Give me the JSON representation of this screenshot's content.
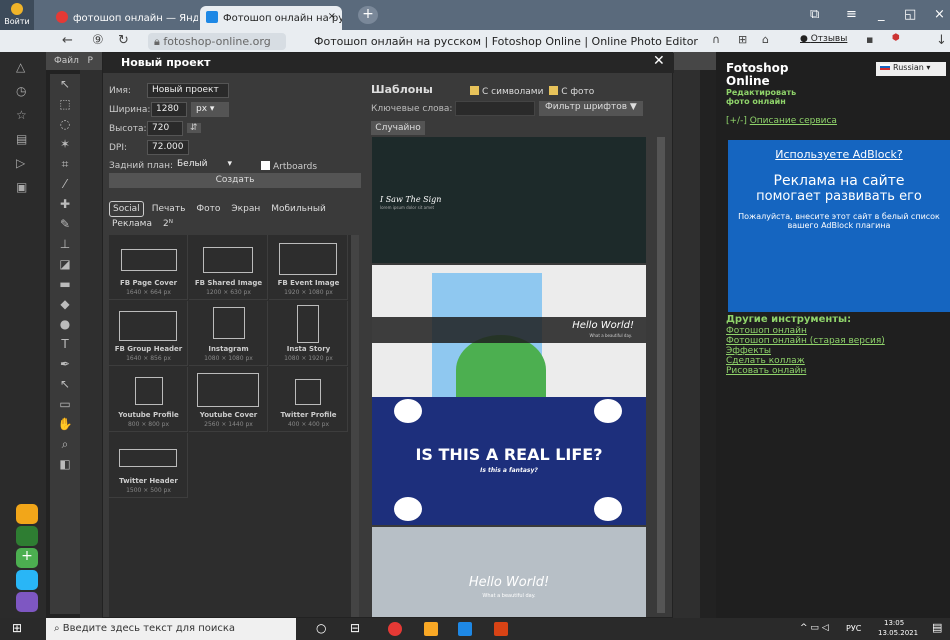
{
  "tabs": {
    "login": "Войти",
    "tab1": "фотошоп онлайн — Яндекс",
    "tab2": "Фотошоп онлайн на русском",
    "tab2_close": "×"
  },
  "address": {
    "url": "fotoshop-online.org",
    "title": "Фотошоп онлайн на русском | Fotoshop Online | Online Photo Editor",
    "reviews": "Отзывы"
  },
  "menu": {
    "file": "Файл",
    "p": "Р"
  },
  "dialog": {
    "title": "Новый проект",
    "name_label": "Имя:",
    "name_value": "Новый проект",
    "width_label": "Ширина:",
    "width_value": "1280",
    "unit": "px",
    "height_label": "Высота:",
    "height_value": "720",
    "dpi_label": "DPI:",
    "dpi_value": "72.000",
    "bg_label": "Задний план:",
    "bg_value": "Белый",
    "artboards": "Artboards",
    "create": "Создать",
    "categories": [
      "Social",
      "Печать",
      "Фото",
      "Экран",
      "Мобильный",
      "Реклама",
      "2ᴺ"
    ],
    "presets": [
      {
        "name": "FB Page Cover",
        "size": "1640 × 664 px"
      },
      {
        "name": "FB Shared Image",
        "size": "1200 × 630 px"
      },
      {
        "name": "FB Event Image",
        "size": "1920 × 1080 px"
      },
      {
        "name": "FB Group Header",
        "size": "1640 × 856 px"
      },
      {
        "name": "Instagram",
        "size": "1080 × 1080 px"
      },
      {
        "name": "Insta Story",
        "size": "1080 × 1920 px"
      },
      {
        "name": "Youtube Profile",
        "size": "800 × 800 px"
      },
      {
        "name": "Youtube Cover",
        "size": "2560 × 1440 px"
      },
      {
        "name": "Twitter Profile",
        "size": "400 × 400 px"
      },
      {
        "name": "Twitter Header",
        "size": "1500 × 500 px"
      }
    ],
    "templates_title": "Шаблоны",
    "chk_symbols": "С символами",
    "chk_photo": "С фото",
    "keywords_label": "Ключевые слова:",
    "font_filter": "Фильтр шрифтов ▼",
    "random": "Случайно",
    "t1_text": "I Saw The Sign",
    "t1_sub": "lorem ipsum dolor sit amet",
    "t2_text": "Hello World!",
    "t2_sub": "What a beautiful day.",
    "t3_text": "IS THIS A REAL LIFE?",
    "t3_sub": "Is this a fantasy?",
    "t4_text": "Hello World!",
    "t4_sub": "What a beautiful day."
  },
  "right": {
    "brand": "Fotoshop Online",
    "tagline1": "Редактировать",
    "tagline2": "фото онлайн",
    "lang": "Russian",
    "desc_prefix": "[+/-]",
    "desc_link": "Описание сервиса",
    "ad_title": "Используете AdBlock?",
    "ad_line1": "Реклама на сайте",
    "ad_line2": "помогает развивать его",
    "ad_small": "Пожалуйста, внесите этот сайт в белый список вашего AdBlock плагина",
    "other_title": "Другие инструменты:",
    "links": [
      "Фотошоп онлайн",
      "Фотошоп онлайн (старая версия)",
      "Эффекты",
      "Сделать коллаж",
      "Рисовать онлайн"
    ]
  },
  "taskbar": {
    "search": "Введите здесь текст для поиска",
    "lang": "РУС",
    "time": "13:05",
    "date": "13.05.2021"
  }
}
